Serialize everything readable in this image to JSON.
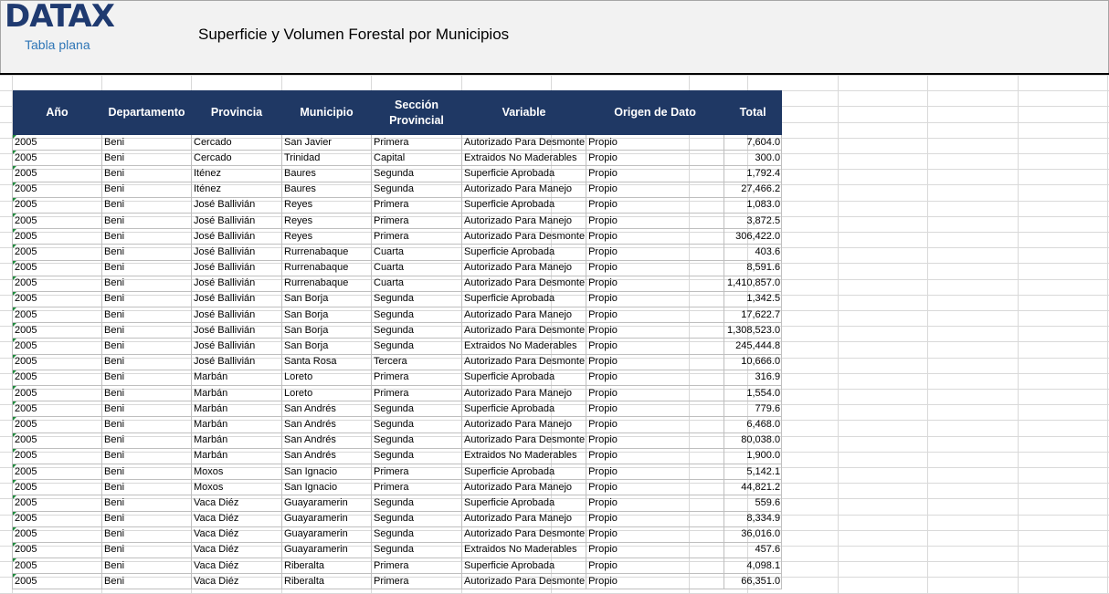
{
  "brand": {
    "logo": "DATAX",
    "subtitle": "Tabla plana"
  },
  "report_title": "Superficie y Volumen Forestal por Municipios",
  "columns": [
    "Año",
    "Departamento",
    "Provincia",
    "Municipio",
    "Sección Provincial",
    "Variable",
    "Origen de Dato",
    "Total"
  ],
  "rows": [
    [
      "2005",
      "Beni",
      "Cercado",
      "San Javier",
      "Primera",
      "Autorizado Para Desmonte",
      "Propio",
      "7,604.0"
    ],
    [
      "2005",
      "Beni",
      "Cercado",
      "Trinidad",
      "Capital",
      "Extraidos No Maderables",
      "Propio",
      "300.0"
    ],
    [
      "2005",
      "Beni",
      "Iténez",
      "Baures",
      "Segunda",
      "Superficie Aprobada",
      "Propio",
      "1,792.4"
    ],
    [
      "2005",
      "Beni",
      "Iténez",
      "Baures",
      "Segunda",
      "Autorizado Para Manejo",
      "Propio",
      "27,466.2"
    ],
    [
      "2005",
      "Beni",
      "José Ballivián",
      "Reyes",
      "Primera",
      "Superficie Aprobada",
      "Propio",
      "1,083.0"
    ],
    [
      "2005",
      "Beni",
      "José Ballivián",
      "Reyes",
      "Primera",
      "Autorizado Para Manejo",
      "Propio",
      "3,872.5"
    ],
    [
      "2005",
      "Beni",
      "José Ballivián",
      "Reyes",
      "Primera",
      "Autorizado Para Desmonte",
      "Propio",
      "306,422.0"
    ],
    [
      "2005",
      "Beni",
      "José Ballivián",
      "Rurrenabaque",
      "Cuarta",
      "Superficie Aprobada",
      "Propio",
      "403.6"
    ],
    [
      "2005",
      "Beni",
      "José Ballivián",
      "Rurrenabaque",
      "Cuarta",
      "Autorizado Para Manejo",
      "Propio",
      "8,591.6"
    ],
    [
      "2005",
      "Beni",
      "José Ballivián",
      "Rurrenabaque",
      "Cuarta",
      "Autorizado Para Desmonte",
      "Propio",
      "1,410,857.0"
    ],
    [
      "2005",
      "Beni",
      "José Ballivián",
      "San Borja",
      "Segunda",
      "Superficie Aprobada",
      "Propio",
      "1,342.5"
    ],
    [
      "2005",
      "Beni",
      "José Ballivián",
      "San Borja",
      "Segunda",
      "Autorizado Para Manejo",
      "Propio",
      "17,622.7"
    ],
    [
      "2005",
      "Beni",
      "José Ballivián",
      "San Borja",
      "Segunda",
      "Autorizado Para Desmonte",
      "Propio",
      "1,308,523.0"
    ],
    [
      "2005",
      "Beni",
      "José Ballivián",
      "San Borja",
      "Segunda",
      "Extraidos No Maderables",
      "Propio",
      "245,444.8"
    ],
    [
      "2005",
      "Beni",
      "José Ballivián",
      "Santa Rosa",
      "Tercera",
      "Autorizado Para Desmonte",
      "Propio",
      "10,666.0"
    ],
    [
      "2005",
      "Beni",
      "Marbán",
      "Loreto",
      "Primera",
      "Superficie Aprobada",
      "Propio",
      "316.9"
    ],
    [
      "2005",
      "Beni",
      "Marbán",
      "Loreto",
      "Primera",
      "Autorizado Para Manejo",
      "Propio",
      "1,554.0"
    ],
    [
      "2005",
      "Beni",
      "Marbán",
      "San Andrés",
      "Segunda",
      "Superficie Aprobada",
      "Propio",
      "779.6"
    ],
    [
      "2005",
      "Beni",
      "Marbán",
      "San Andrés",
      "Segunda",
      "Autorizado Para Manejo",
      "Propio",
      "6,468.0"
    ],
    [
      "2005",
      "Beni",
      "Marbán",
      "San Andrés",
      "Segunda",
      "Autorizado Para Desmonte",
      "Propio",
      "80,038.0"
    ],
    [
      "2005",
      "Beni",
      "Marbán",
      "San Andrés",
      "Segunda",
      "Extraidos No Maderables",
      "Propio",
      "1,900.0"
    ],
    [
      "2005",
      "Beni",
      "Moxos",
      "San Ignacio",
      "Primera",
      "Superficie Aprobada",
      "Propio",
      "5,142.1"
    ],
    [
      "2005",
      "Beni",
      "Moxos",
      "San Ignacio",
      "Primera",
      "Autorizado Para Manejo",
      "Propio",
      "44,821.2"
    ],
    [
      "2005",
      "Beni",
      "Vaca Diéz",
      "Guayaramerin",
      "Segunda",
      "Superficie Aprobada",
      "Propio",
      "559.6"
    ],
    [
      "2005",
      "Beni",
      "Vaca Diéz",
      "Guayaramerin",
      "Segunda",
      "Autorizado Para Manejo",
      "Propio",
      "8,334.9"
    ],
    [
      "2005",
      "Beni",
      "Vaca Diéz",
      "Guayaramerin",
      "Segunda",
      "Autorizado Para Desmonte",
      "Propio",
      "36,016.0"
    ],
    [
      "2005",
      "Beni",
      "Vaca Diéz",
      "Guayaramerin",
      "Segunda",
      "Extraidos No Maderables",
      "Propio",
      "457.6"
    ],
    [
      "2005",
      "Beni",
      "Vaca Diéz",
      "Riberalta",
      "Primera",
      "Superficie Aprobada",
      "Propio",
      "4,098.1"
    ],
    [
      "2005",
      "Beni",
      "Vaca Diéz",
      "Riberalta",
      "Primera",
      "Autorizado Para Desmonte",
      "Propio",
      "66,351.0"
    ]
  ]
}
